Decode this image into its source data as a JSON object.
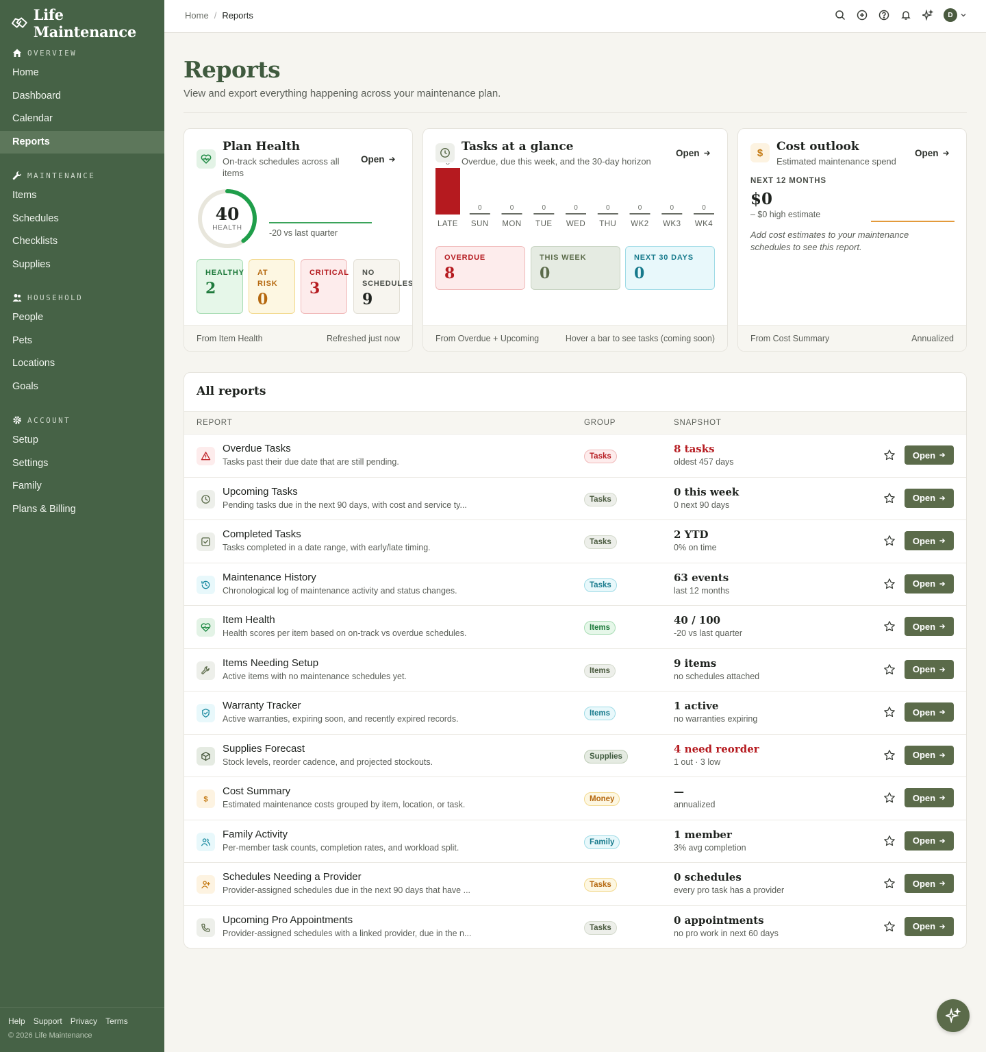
{
  "app": {
    "name": "Life Maintenance"
  },
  "sidebar": {
    "sections": [
      {
        "title": "OVERVIEW",
        "icon": "home-icon",
        "items": [
          "Home",
          "Dashboard",
          "Calendar",
          "Reports"
        ]
      },
      {
        "title": "MAINTENANCE",
        "icon": "wrench-icon",
        "items": [
          "Items",
          "Schedules",
          "Checklists",
          "Supplies"
        ]
      },
      {
        "title": "HOUSEHOLD",
        "icon": "people-icon",
        "items": [
          "People",
          "Pets",
          "Locations",
          "Goals"
        ]
      },
      {
        "title": "ACCOUNT",
        "icon": "gear-icon",
        "items": [
          "Setup",
          "Settings",
          "Family",
          "Plans & Billing"
        ]
      }
    ],
    "active": "Reports",
    "footer_links": [
      "Help",
      "Support",
      "Privacy",
      "Terms"
    ],
    "copyright": "© 2026 Life Maintenance"
  },
  "topbar": {
    "breadcrumb": [
      "Home",
      "Reports"
    ],
    "breadcrumb_sep": "/",
    "avatar_initial": "D"
  },
  "page": {
    "title": "Reports",
    "subtitle": "View and export everything happening across your maintenance plan."
  },
  "plan_health": {
    "title": "Plan Health",
    "desc_line1": "On-track schedules across all",
    "desc_line2": "items",
    "open": "Open",
    "score": "40",
    "score_label": "HEALTH",
    "score_value": 40,
    "delta": "-20 vs last quarter",
    "stats": [
      {
        "label1": "HEALTHY",
        "label2": "",
        "value": "2"
      },
      {
        "label1": "AT",
        "label2": "RISK",
        "value": "0"
      },
      {
        "label1": "CRITICAL",
        "label2": "",
        "value": "3"
      },
      {
        "label1": "NO",
        "label2": "SCHEDULES",
        "value": "9"
      }
    ],
    "foot_left": "From Item Health",
    "foot_right": "Refreshed just now",
    "colors": {
      "ring": "#1f9e4a",
      "ring_bg": "#e8e6dc"
    }
  },
  "tasks_glance": {
    "title": "Tasks at a glance",
    "desc": "Overdue, due this week, and the 30-day horizon",
    "open": "Open",
    "chart_data": {
      "type": "bar",
      "categories": [
        "LATE",
        "SUN",
        "MON",
        "TUE",
        "WED",
        "THU",
        "WK2",
        "WK3",
        "WK4"
      ],
      "values": [
        8,
        0,
        0,
        0,
        0,
        0,
        0,
        0,
        0
      ]
    },
    "buckets": [
      {
        "label": "OVERDUE",
        "value": "8"
      },
      {
        "label": "THIS WEEK",
        "value": "0"
      },
      {
        "label": "NEXT 30 DAYS",
        "value": "0"
      }
    ],
    "foot_left": "From Overdue + Upcoming",
    "foot_right": "Hover a bar to see tasks (coming soon)",
    "colors": {
      "late": "#b51a1f"
    }
  },
  "cost_outlook": {
    "title": "Cost outlook",
    "desc": "Estimated maintenance spend",
    "open": "Open",
    "period": "NEXT 12 MONTHS",
    "amount": "$0",
    "high": "– $0 high estimate",
    "note_line1": "Add cost estimates to your maintenance",
    "note_line2": "schedules to see this report.",
    "foot_left": "From Cost Summary",
    "foot_right": "Annualized",
    "colors": {
      "line": "#e39a3b"
    }
  },
  "reports": {
    "title": "All reports",
    "columns": [
      "REPORT",
      "GROUP",
      "SNAPSHOT"
    ],
    "open_label": "Open",
    "rows": [
      {
        "icon": "alert-icon",
        "name": "Overdue Tasks",
        "desc": "Tasks past their due date that are still pending.",
        "group": "Tasks",
        "snap": "8 tasks",
        "snap_sub": "oldest 457 days"
      },
      {
        "icon": "clock-icon",
        "name": "Upcoming Tasks",
        "desc": "Pending tasks due in the next 90 days, with cost and service ty...",
        "group": "Tasks",
        "snap": "0 this week",
        "snap_sub": "0 next 90 days"
      },
      {
        "icon": "check-square-icon",
        "name": "Completed Tasks",
        "desc": "Tasks completed in a date range, with early/late timing.",
        "group": "Tasks",
        "snap": "2 YTD",
        "snap_sub": "0% on time"
      },
      {
        "icon": "history-icon",
        "name": "Maintenance History",
        "desc": "Chronological log of maintenance activity and status changes.",
        "group": "Tasks",
        "snap": "63 events",
        "snap_sub": "last 12 months"
      },
      {
        "icon": "heart-pulse-icon",
        "name": "Item Health",
        "desc": "Health scores per item based on on-track vs overdue schedules.",
        "group": "Items",
        "snap": "40 / 100",
        "snap_sub": "-20 vs last quarter"
      },
      {
        "icon": "wrench-icon",
        "name": "Items Needing Setup",
        "desc": "Active items with no maintenance schedules yet.",
        "group": "Items",
        "snap": "9 items",
        "snap_sub": "no schedules attached"
      },
      {
        "icon": "shield-check-icon",
        "name": "Warranty Tracker",
        "desc": "Active warranties, expiring soon, and recently expired records.",
        "group": "Items",
        "snap": "1 active",
        "snap_sub": "no warranties expiring"
      },
      {
        "icon": "box-icon",
        "name": "Supplies Forecast",
        "desc": "Stock levels, reorder cadence, and projected stockouts.",
        "group": "Supplies",
        "snap": "4 need reorder",
        "snap_sub": "1 out · 3 low"
      },
      {
        "icon": "dollar-icon",
        "name": "Cost Summary",
        "desc": "Estimated maintenance costs grouped by item, location, or task.",
        "group": "Money",
        "snap": "—",
        "snap_sub": "annualized"
      },
      {
        "icon": "users-icon",
        "name": "Family Activity",
        "desc": "Per-member task counts, completion rates, and workload split.",
        "group": "Family",
        "snap": "1 member",
        "snap_sub": "3% avg completion"
      },
      {
        "icon": "user-plus-icon",
        "name": "Schedules Needing a Provider",
        "desc": "Provider-assigned schedules due in the next 90 days that have ...",
        "group": "Tasks",
        "snap": "0 schedules",
        "snap_sub": "every pro task has a provider"
      },
      {
        "icon": "phone-icon",
        "name": "Upcoming Pro Appointments",
        "desc": "Provider-assigned schedules with a linked provider, due in the n...",
        "group": "Tasks",
        "snap": "0 appointments",
        "snap_sub": "no pro work in next 60 days"
      }
    ]
  }
}
